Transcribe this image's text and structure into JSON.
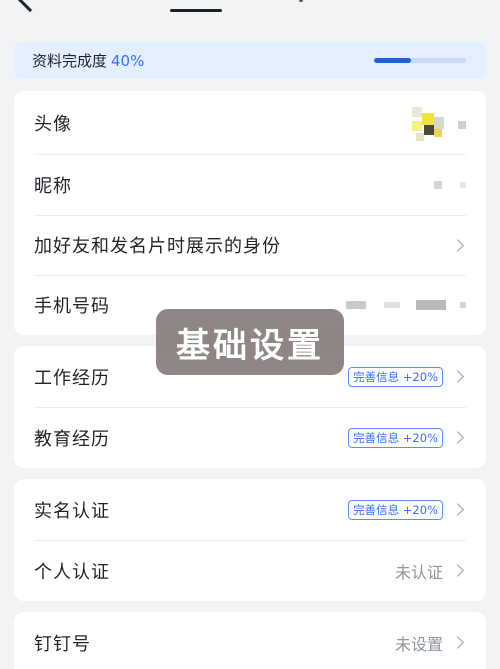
{
  "progress": {
    "label": "资料完成度",
    "value_text": "40%",
    "fraction": 0.4
  },
  "basic_card": {
    "rows": [
      {
        "label": "头像"
      },
      {
        "label": "昵称"
      },
      {
        "label": "加好友和发名片时展示的身份"
      },
      {
        "label": "手机号码"
      }
    ]
  },
  "experience_card": {
    "rows": [
      {
        "label": "工作经历",
        "badge": "完善信息 +20%"
      },
      {
        "label": "教育经历",
        "badge": "完善信息 +20%"
      }
    ]
  },
  "verify_card": {
    "rows": [
      {
        "label": "实名认证",
        "badge": "完善信息 +20%"
      },
      {
        "label": "个人认证",
        "value": "未认证"
      }
    ]
  },
  "id_card": {
    "rows": [
      {
        "label": "钉钉号",
        "value": "未设置"
      }
    ]
  },
  "overlay": {
    "text": "基础设置"
  },
  "colors": {
    "accent": "#3370ff",
    "progress_bg": "#e3efff",
    "page_bg": "#f2f3f5",
    "overlay_bg": "#7d7170"
  }
}
